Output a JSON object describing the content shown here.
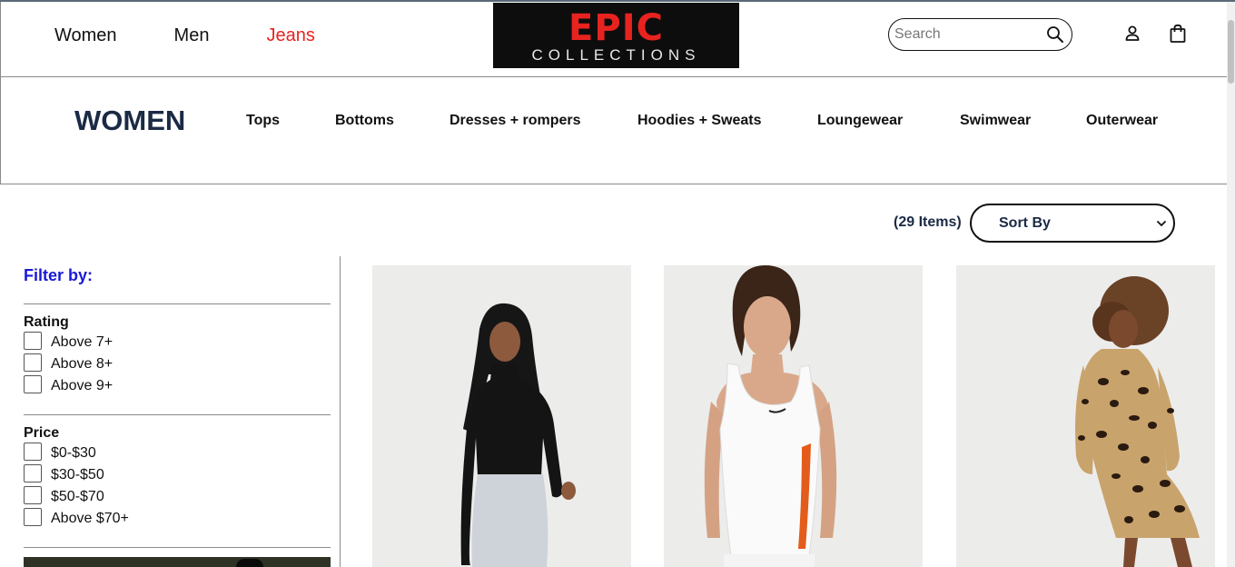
{
  "header": {
    "nav": [
      {
        "label": "Women",
        "active": false
      },
      {
        "label": "Men",
        "active": false
      },
      {
        "label": "Jeans",
        "active": true
      }
    ],
    "logo": {
      "top": "EPIC",
      "bottom": "COLLECTIONS"
    },
    "search": {
      "placeholder": "Search",
      "value": ""
    },
    "icons": [
      "search-icon",
      "user-icon",
      "shopping-bag-icon"
    ]
  },
  "category": {
    "title": "WOMEN",
    "links": [
      "Tops",
      "Bottoms",
      "Dresses + rompers",
      "Hoodies + Sweats",
      "Loungewear",
      "Swimwear",
      "Outerwear"
    ]
  },
  "toolbar": {
    "items_count": "(29 Items)",
    "sort_label": "Sort By"
  },
  "filters": {
    "title": "Filter by:",
    "groups": [
      {
        "title": "Rating",
        "options": [
          "Above 7+",
          "Above 8+",
          "Above 9+"
        ]
      },
      {
        "title": "Price",
        "options": [
          "$0-$30",
          "$30-$50",
          "$50-$70",
          "Above $70+"
        ]
      }
    ]
  },
  "products": [
    {
      "description_icon": "model-black-top-photo"
    },
    {
      "description_icon": "model-white-tank-photo"
    },
    {
      "description_icon": "model-leopard-dress-photo"
    }
  ],
  "colors": {
    "accent_red": "#e8231f",
    "navy": "#1b2a45",
    "filter_blue": "#1a1ad8",
    "logo_bg": "#0d0d0d"
  }
}
